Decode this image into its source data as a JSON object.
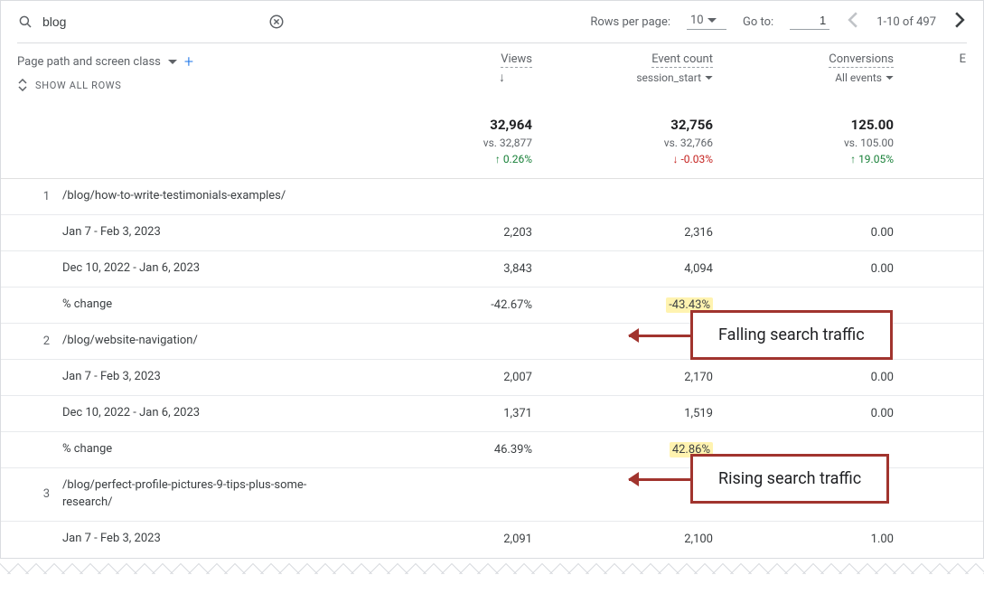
{
  "search": {
    "value": "blog"
  },
  "pager": {
    "rows_per_page_label": "Rows per page:",
    "rows_per_page_value": "10",
    "goto_label": "Go to:",
    "goto_value": "1",
    "range_text": "1-10 of 497"
  },
  "dimension": {
    "label": "Page path and screen class",
    "show_all_label": "SHOW ALL ROWS"
  },
  "metrics": {
    "views": {
      "title": "Views"
    },
    "event_count": {
      "title": "Event count",
      "sub": "session_start"
    },
    "conversions": {
      "title": "Conversions",
      "sub": "All events"
    },
    "edge": "E"
  },
  "summary": {
    "views": {
      "main": "32,964",
      "vs": "vs. 32,877",
      "delta": "0.26%",
      "dir": "up"
    },
    "event_count": {
      "main": "32,756",
      "vs": "vs. 32,766",
      "delta": "-0.03%",
      "dir": "down"
    },
    "conversions": {
      "main": "125.00",
      "vs": "vs. 105.00",
      "delta": "19.05%",
      "dir": "up"
    }
  },
  "rows": [
    {
      "idx": "1",
      "path": "/blog/how-to-write-testimonials-examples/",
      "p1": {
        "label": "Jan 7 - Feb 3, 2023",
        "views": "2,203",
        "events": "2,316",
        "conv": "0.00"
      },
      "p2": {
        "label": "Dec 10, 2022 - Jan 6, 2023",
        "views": "3,843",
        "events": "4,094",
        "conv": "0.00"
      },
      "change": {
        "label": "% change",
        "views": "-42.67%",
        "events": "-43.43%",
        "conv": ""
      }
    },
    {
      "idx": "2",
      "path": "/blog/website-navigation/",
      "p1": {
        "label": "Jan 7 - Feb 3, 2023",
        "views": "2,007",
        "events": "2,170",
        "conv": "0.00"
      },
      "p2": {
        "label": "Dec 10, 2022 - Jan 6, 2023",
        "views": "1,371",
        "events": "1,519",
        "conv": "0.00"
      },
      "change": {
        "label": "% change",
        "views": "46.39%",
        "events": "42.86%",
        "conv": ""
      }
    },
    {
      "idx": "3",
      "path": "/blog/perfect-profile-pictures-9-tips-plus-some-research/",
      "p1": {
        "label": "Jan 7 - Feb 3, 2023",
        "views": "2,091",
        "events": "2,100",
        "conv": "1.00"
      }
    }
  ],
  "annotations": {
    "falling": "Falling search traffic",
    "rising": "Rising search traffic"
  }
}
